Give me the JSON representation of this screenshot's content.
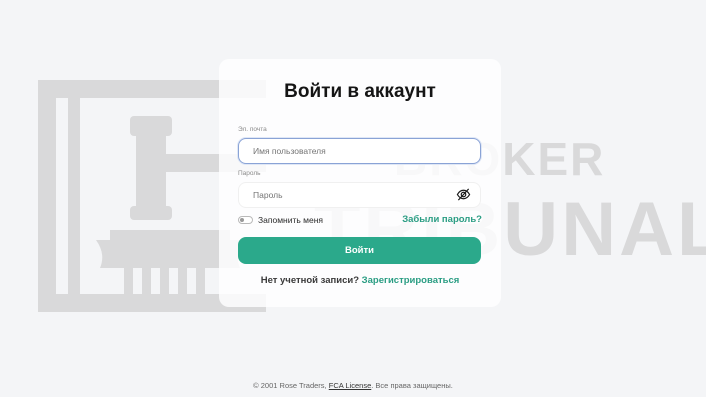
{
  "watermark": {
    "line1": "BROKER",
    "line2": "TRIBUNAL"
  },
  "form": {
    "title": "Войти в аккаунт",
    "email_label": "Эл. почта",
    "email_placeholder": "Имя пользователя",
    "password_label": "Пароль",
    "password_placeholder": "Пароль",
    "remember_label": "Запомнить меня",
    "forgot_label": "Забыли пароль?",
    "login_button": "Войти",
    "no_account_text": "Нет учетной записи?",
    "signup_link": "Зарегистрироваться"
  },
  "footer": {
    "prefix": "© 2001 Rose Traders,",
    "license_link": "FCA License",
    "suffix": ". Все права защищены."
  },
  "colors": {
    "accent": "#2ba98b",
    "link": "#2a9d83",
    "background": "#f4f5f7"
  },
  "icons": {
    "password_toggle": "eye-slash-icon"
  }
}
